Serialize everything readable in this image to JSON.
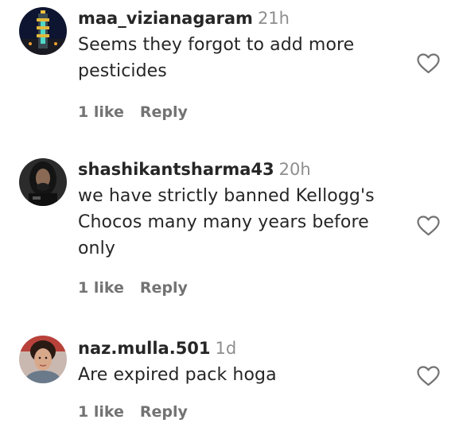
{
  "comments": [
    {
      "username": "maa_vizianagaram",
      "time": "21h",
      "text": "Seems they forgot to add more pesticides",
      "likes": "1 like",
      "reply": "Reply",
      "avatar_icon": "temple-tower-photo",
      "like_icon": "heart-outline-icon"
    },
    {
      "username": "shashikantsharma43",
      "time": "20h",
      "text": "we have strictly banned Kellogg's Chocos many many years before only",
      "likes": "1 like",
      "reply": "Reply",
      "avatar_icon": "person-long-hair-photo",
      "like_icon": "heart-outline-icon"
    },
    {
      "username": "naz.mulla.501",
      "time": "1d",
      "text": "Are expired pack hoga",
      "likes": "1 like",
      "reply": "Reply",
      "avatar_icon": "woman-selfie-photo",
      "like_icon": "heart-outline-icon"
    }
  ],
  "colors": {
    "text": "#262626",
    "muted": "#8e8e8e",
    "action": "#737373"
  }
}
